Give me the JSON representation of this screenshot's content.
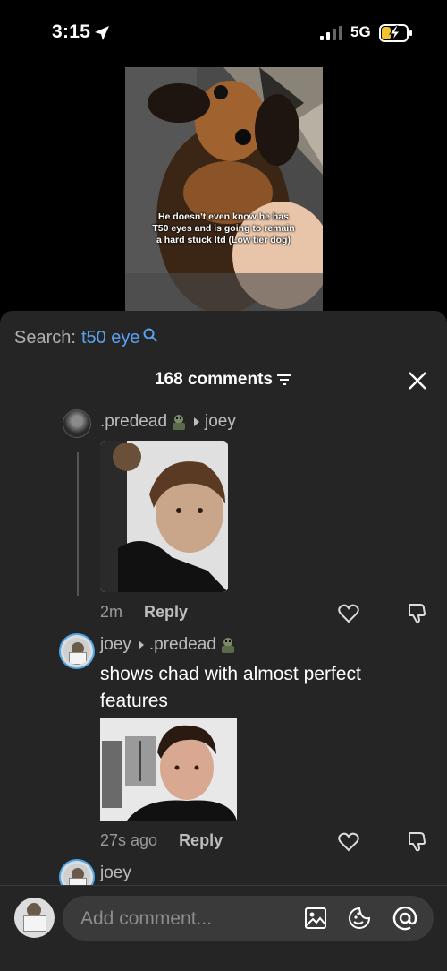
{
  "status_bar": {
    "time": "3:15",
    "network": "5G"
  },
  "video": {
    "caption": "He doesn't even know he has T50 eyes and is going to remain a hard stuck ltd (Low tier dog)"
  },
  "search": {
    "label": "Search:",
    "term": "t50 eye"
  },
  "comments": {
    "count_label": "168 comments"
  },
  "comment_1": {
    "author": ".predead",
    "reply_to": "joey",
    "time": "2m",
    "reply_label": "Reply"
  },
  "comment_2": {
    "author": "joey",
    "reply_to": ".predead",
    "text": "shows chad with almost perfect features",
    "time": "27s ago",
    "reply_label": "Reply"
  },
  "comment_3": {
    "author": "joey"
  },
  "composer": {
    "placeholder": "Add comment..."
  },
  "colors": {
    "accent": "#5aa2f0",
    "sheet": "#252525"
  }
}
